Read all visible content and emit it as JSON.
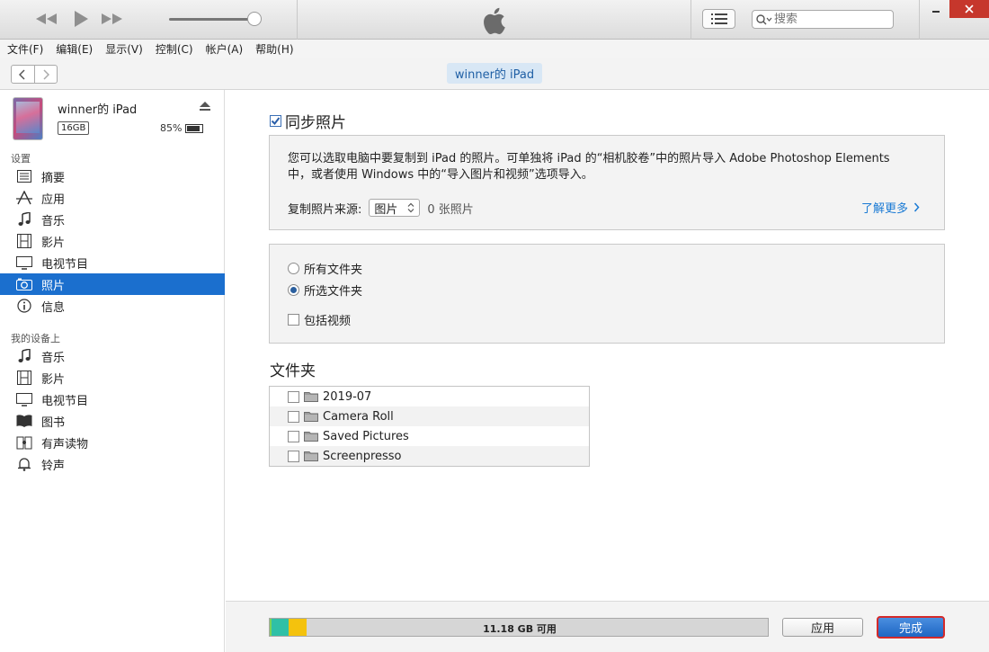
{
  "topbar": {
    "search_placeholder": "搜索",
    "window_controls": [
      "minimize-icon",
      "maximize-icon",
      "close-icon"
    ]
  },
  "menu": {
    "items": [
      "文件(F)",
      "编辑(E)",
      "显示(V)",
      "控制(C)",
      "帐户(A)",
      "帮助(H)"
    ]
  },
  "nav": {
    "back": "<",
    "forward": ">",
    "device_pill": "winner的 iPad"
  },
  "device": {
    "name": "winner的 iPad",
    "capacity": "16GB",
    "battery": "85%"
  },
  "sidebar": {
    "settings_label": "设置",
    "settings_items": [
      {
        "label": "摘要",
        "icon": "summary-icon"
      },
      {
        "label": "应用",
        "icon": "apps-icon"
      },
      {
        "label": "音乐",
        "icon": "music-icon"
      },
      {
        "label": "影片",
        "icon": "film-icon"
      },
      {
        "label": "电视节目",
        "icon": "tv-icon"
      },
      {
        "label": "照片",
        "icon": "camera-icon"
      },
      {
        "label": "信息",
        "icon": "info-icon"
      }
    ],
    "selected_index": 5,
    "ondevice_label": "我的设备上",
    "ondevice_items": [
      {
        "label": "音乐",
        "icon": "music-icon"
      },
      {
        "label": "影片",
        "icon": "film-icon"
      },
      {
        "label": "电视节目",
        "icon": "tv-icon"
      },
      {
        "label": "图书",
        "icon": "book-icon"
      },
      {
        "label": "有声读物",
        "icon": "audiobook-icon"
      },
      {
        "label": "铃声",
        "icon": "bell-icon"
      }
    ]
  },
  "main": {
    "sync_title": "同步照片",
    "sync_checked": true,
    "description_line1": "您可以选取电脑中要复制到 iPad 的照片。可单独将 iPad 的“相机胶卷”中的照片导入 Adobe Photoshop Elements",
    "description_line2": "中，或者使用 Windows 中的“导入图片和视频”选项导入。",
    "source_label": "复制照片来源:",
    "source_value": "图片",
    "photo_count": "0 张照片",
    "learn_more": "了解更多",
    "options": [
      {
        "label": "所有文件夹",
        "type": "radio",
        "checked": false
      },
      {
        "label": "所选文件夹",
        "type": "radio",
        "checked": true
      },
      {
        "label": "包括视频",
        "type": "checkbox",
        "checked": false
      }
    ],
    "folders_title": "文件夹",
    "folders": [
      "2019-07",
      "Camera Roll",
      "Saved Pictures",
      "Screenpresso"
    ]
  },
  "bottom": {
    "storage_label": "11.18 GB 可用",
    "storage_segments": [
      {
        "color": "#7ed257",
        "fraction": 0.004
      },
      {
        "color": "#2fc0a6",
        "fraction": 0.034
      },
      {
        "color": "#f4c20d",
        "fraction": 0.036
      }
    ],
    "apply_label": "应用",
    "done_label": "完成"
  },
  "colors": {
    "accent": "#1b6fce",
    "link": "#1a7ad4",
    "done_outline": "#d42a2a"
  }
}
